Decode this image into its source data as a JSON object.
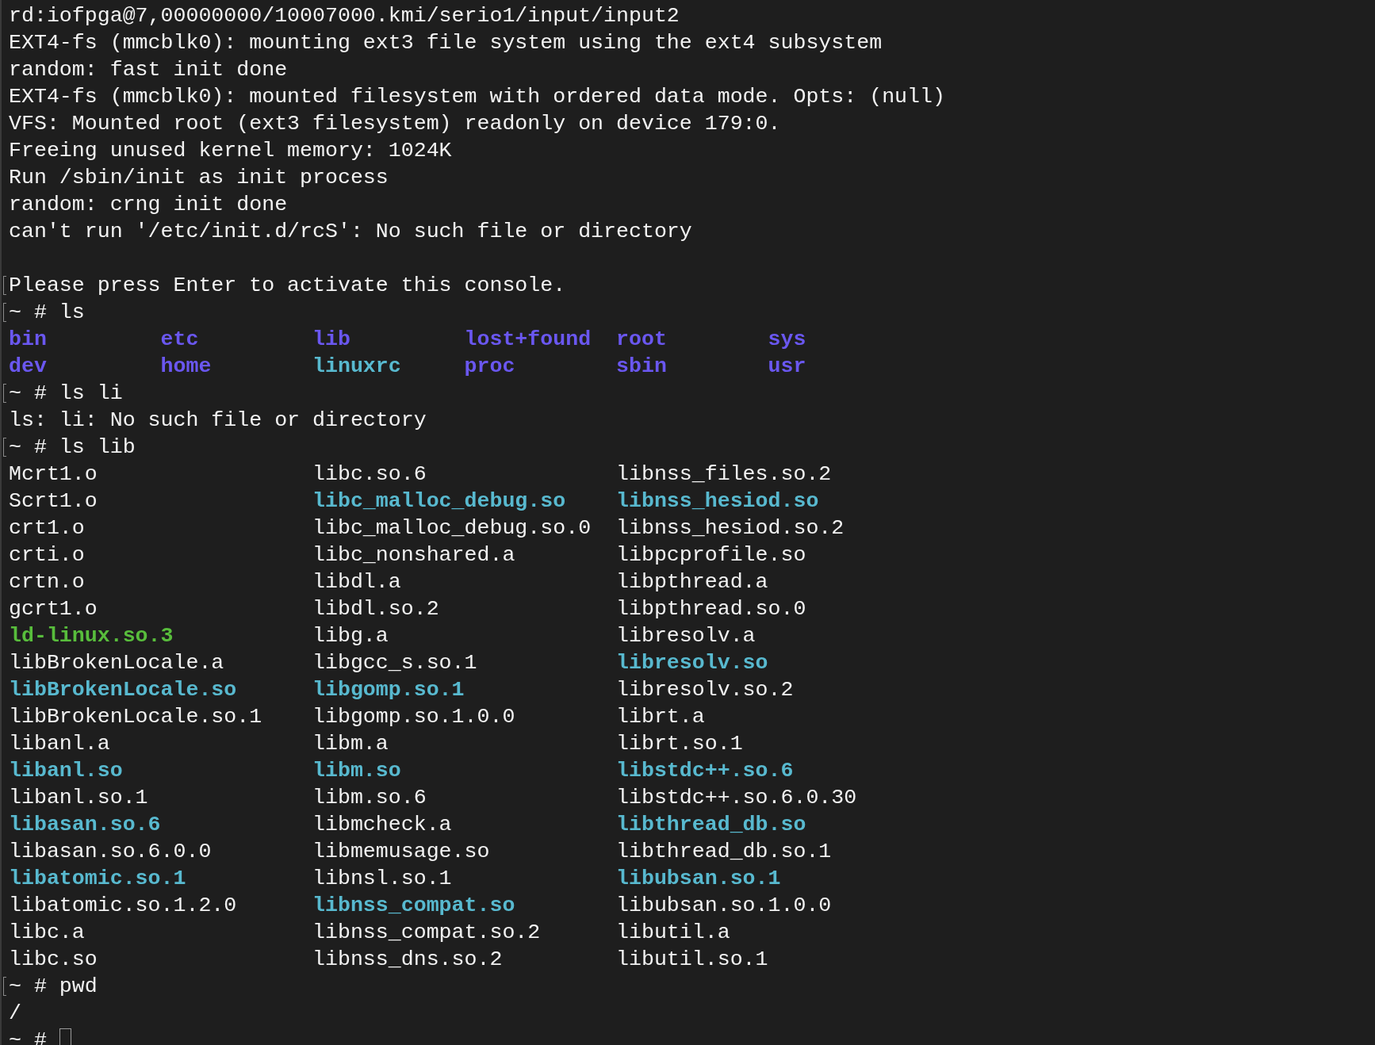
{
  "terminal": {
    "lines": [
      {
        "kind": "text",
        "marked": false,
        "text": "rd:iofpga@7,00000000/10007000.kmi/serio1/input/input2"
      },
      {
        "kind": "text",
        "marked": false,
        "text": "EXT4-fs (mmcblk0): mounting ext3 file system using the ext4 subsystem"
      },
      {
        "kind": "text",
        "marked": false,
        "text": "random: fast init done"
      },
      {
        "kind": "text",
        "marked": false,
        "text": "EXT4-fs (mmcblk0): mounted filesystem with ordered data mode. Opts: (null)"
      },
      {
        "kind": "text",
        "marked": false,
        "text": "VFS: Mounted root (ext3 filesystem) readonly on device 179:0."
      },
      {
        "kind": "text",
        "marked": false,
        "text": "Freeing unused kernel memory: 1024K"
      },
      {
        "kind": "text",
        "marked": false,
        "text": "Run /sbin/init as init process"
      },
      {
        "kind": "text",
        "marked": false,
        "text": "random: crng init done"
      },
      {
        "kind": "text",
        "marked": false,
        "text": "can't run '/etc/init.d/rcS': No such file or directory"
      },
      {
        "kind": "blank",
        "marked": false
      },
      {
        "kind": "text",
        "marked": true,
        "text": "Please press Enter to activate this console."
      },
      {
        "kind": "prompt",
        "marked": true,
        "text": "~ # ls",
        "cursor": false
      },
      {
        "kind": "listing",
        "marked": false,
        "columns": [
          [
            {
              "name": "bin",
              "color": "#6a57f0",
              "bold": true
            },
            {
              "name": "dev",
              "color": "#6a57f0",
              "bold": true
            }
          ],
          [
            {
              "name": "etc",
              "color": "#6a57f0",
              "bold": true
            },
            {
              "name": "home",
              "color": "#6a57f0",
              "bold": true
            }
          ],
          [
            {
              "name": "lib",
              "color": "#6a57f0",
              "bold": true
            },
            {
              "name": "linuxrc",
              "color": "#58b9cf",
              "bold": true
            }
          ],
          [
            {
              "name": "lost+found",
              "color": "#6a57f0",
              "bold": true
            },
            {
              "name": "proc",
              "color": "#6a57f0",
              "bold": true
            }
          ],
          [
            {
              "name": "root",
              "color": "#6a57f0",
              "bold": true
            },
            {
              "name": "sbin",
              "color": "#6a57f0",
              "bold": true
            }
          ],
          [
            {
              "name": "sys",
              "color": "#6a57f0",
              "bold": true
            },
            {
              "name": "usr",
              "color": "#6a57f0",
              "bold": true
            }
          ]
        ]
      },
      {
        "kind": "prompt",
        "marked": true,
        "text": "~ # ls li",
        "cursor": false
      },
      {
        "kind": "text",
        "marked": false,
        "text": "ls: li: No such file or directory"
      },
      {
        "kind": "prompt",
        "marked": true,
        "text": "~ # ls lib",
        "cursor": false
      },
      {
        "kind": "listing",
        "marked": false,
        "columns": [
          [
            {
              "name": "Mcrt1.o",
              "color": "#f2f2f2",
              "bold": false
            },
            {
              "name": "Scrt1.o",
              "color": "#f2f2f2",
              "bold": false
            },
            {
              "name": "crt1.o",
              "color": "#f2f2f2",
              "bold": false
            },
            {
              "name": "crti.o",
              "color": "#f2f2f2",
              "bold": false
            },
            {
              "name": "crtn.o",
              "color": "#f2f2f2",
              "bold": false
            },
            {
              "name": "gcrt1.o",
              "color": "#f2f2f2",
              "bold": false
            },
            {
              "name": "ld-linux.so.3",
              "color": "#58bd3c",
              "bold": true
            },
            {
              "name": "libBrokenLocale.a",
              "color": "#f2f2f2",
              "bold": false
            },
            {
              "name": "libBrokenLocale.so",
              "color": "#58b9cf",
              "bold": true
            },
            {
              "name": "libBrokenLocale.so.1",
              "color": "#f2f2f2",
              "bold": false
            },
            {
              "name": "libanl.a",
              "color": "#f2f2f2",
              "bold": false
            },
            {
              "name": "libanl.so",
              "color": "#58b9cf",
              "bold": true
            },
            {
              "name": "libanl.so.1",
              "color": "#f2f2f2",
              "bold": false
            },
            {
              "name": "libasan.so.6",
              "color": "#58b9cf",
              "bold": true
            },
            {
              "name": "libasan.so.6.0.0",
              "color": "#f2f2f2",
              "bold": false
            },
            {
              "name": "libatomic.so.1",
              "color": "#58b9cf",
              "bold": true
            },
            {
              "name": "libatomic.so.1.2.0",
              "color": "#f2f2f2",
              "bold": false
            },
            {
              "name": "libc.a",
              "color": "#f2f2f2",
              "bold": false
            },
            {
              "name": "libc.so",
              "color": "#f2f2f2",
              "bold": false
            }
          ],
          [
            {
              "name": "libc.so.6",
              "color": "#f2f2f2",
              "bold": false
            },
            {
              "name": "libc_malloc_debug.so",
              "color": "#58b9cf",
              "bold": true
            },
            {
              "name": "libc_malloc_debug.so.0",
              "color": "#f2f2f2",
              "bold": false
            },
            {
              "name": "libc_nonshared.a",
              "color": "#f2f2f2",
              "bold": false
            },
            {
              "name": "libdl.a",
              "color": "#f2f2f2",
              "bold": false
            },
            {
              "name": "libdl.so.2",
              "color": "#f2f2f2",
              "bold": false
            },
            {
              "name": "libg.a",
              "color": "#f2f2f2",
              "bold": false
            },
            {
              "name": "libgcc_s.so.1",
              "color": "#f2f2f2",
              "bold": false
            },
            {
              "name": "libgomp.so.1",
              "color": "#58b9cf",
              "bold": true
            },
            {
              "name": "libgomp.so.1.0.0",
              "color": "#f2f2f2",
              "bold": false
            },
            {
              "name": "libm.a",
              "color": "#f2f2f2",
              "bold": false
            },
            {
              "name": "libm.so",
              "color": "#58b9cf",
              "bold": true
            },
            {
              "name": "libm.so.6",
              "color": "#f2f2f2",
              "bold": false
            },
            {
              "name": "libmcheck.a",
              "color": "#f2f2f2",
              "bold": false
            },
            {
              "name": "libmemusage.so",
              "color": "#f2f2f2",
              "bold": false
            },
            {
              "name": "libnsl.so.1",
              "color": "#f2f2f2",
              "bold": false
            },
            {
              "name": "libnss_compat.so",
              "color": "#58b9cf",
              "bold": true
            },
            {
              "name": "libnss_compat.so.2",
              "color": "#f2f2f2",
              "bold": false
            },
            {
              "name": "libnss_dns.so.2",
              "color": "#f2f2f2",
              "bold": false
            }
          ],
          [
            {
              "name": "libnss_files.so.2",
              "color": "#f2f2f2",
              "bold": false
            },
            {
              "name": "libnss_hesiod.so",
              "color": "#58b9cf",
              "bold": true
            },
            {
              "name": "libnss_hesiod.so.2",
              "color": "#f2f2f2",
              "bold": false
            },
            {
              "name": "libpcprofile.so",
              "color": "#f2f2f2",
              "bold": false
            },
            {
              "name": "libpthread.a",
              "color": "#f2f2f2",
              "bold": false
            },
            {
              "name": "libpthread.so.0",
              "color": "#f2f2f2",
              "bold": false
            },
            {
              "name": "libresolv.a",
              "color": "#f2f2f2",
              "bold": false
            },
            {
              "name": "libresolv.so",
              "color": "#58b9cf",
              "bold": true
            },
            {
              "name": "libresolv.so.2",
              "color": "#f2f2f2",
              "bold": false
            },
            {
              "name": "librt.a",
              "color": "#f2f2f2",
              "bold": false
            },
            {
              "name": "librt.so.1",
              "color": "#f2f2f2",
              "bold": false
            },
            {
              "name": "libstdc++.so.6",
              "color": "#58b9cf",
              "bold": true
            },
            {
              "name": "libstdc++.so.6.0.30",
              "color": "#f2f2f2",
              "bold": false
            },
            {
              "name": "libthread_db.so",
              "color": "#58b9cf",
              "bold": true
            },
            {
              "name": "libthread_db.so.1",
              "color": "#f2f2f2",
              "bold": false
            },
            {
              "name": "libubsan.so.1",
              "color": "#58b9cf",
              "bold": true
            },
            {
              "name": "libubsan.so.1.0.0",
              "color": "#f2f2f2",
              "bold": false
            },
            {
              "name": "libutil.a",
              "color": "#f2f2f2",
              "bold": false
            },
            {
              "name": "libutil.so.1",
              "color": "#f2f2f2",
              "bold": false
            }
          ]
        ]
      },
      {
        "kind": "prompt",
        "marked": true,
        "text": "~ # pwd",
        "cursor": false
      },
      {
        "kind": "text",
        "marked": false,
        "text": "/"
      },
      {
        "kind": "prompt",
        "marked": false,
        "text": "~ #",
        "cursor": true
      }
    ]
  }
}
